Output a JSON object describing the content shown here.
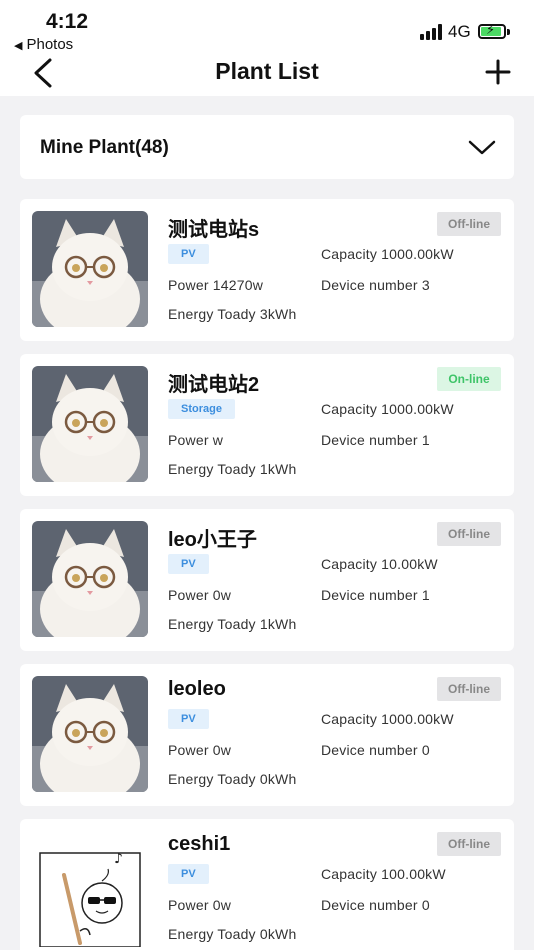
{
  "status_bar": {
    "time": "4:12",
    "back_app": "Photos",
    "network": "4G",
    "battery_color": "#4cd964"
  },
  "nav": {
    "title": "Plant List",
    "back_icon": "chevron-left-icon",
    "add_icon": "plus-icon"
  },
  "filter": {
    "label": "Mine Plant(48)",
    "icon": "chevron-down-icon"
  },
  "plants": [
    {
      "name": "测试电站s",
      "status": "Off-line",
      "type": "PV",
      "capacity": "Capacity  1000.00kW",
      "power": "Power  14270w",
      "devices": "Device number  3",
      "energy": "Energy Toady  3kWh",
      "thumb": "cat"
    },
    {
      "name": "测试电站2",
      "status": "On-line",
      "type": "Storage",
      "capacity": "Capacity  1000.00kW",
      "power": "Power  w",
      "devices": "Device number  1",
      "energy": "Energy Toady  1kWh",
      "thumb": "cat"
    },
    {
      "name": "leo小王子",
      "status": "Off-line",
      "type": "PV",
      "capacity": "Capacity  10.00kW",
      "power": "Power  0w",
      "devices": "Device number  1",
      "energy": "Energy Toady  1kWh",
      "thumb": "cat"
    },
    {
      "name": "leoleo",
      "status": "Off-line",
      "type": "PV",
      "capacity": "Capacity  1000.00kW",
      "power": "Power  0w",
      "devices": "Device number  0",
      "energy": "Energy Toady  0kWh",
      "thumb": "cat"
    },
    {
      "name": "ceshi1",
      "status": "Off-line",
      "type": "PV",
      "capacity": "Capacity  100.00kW",
      "power": "Power  0w",
      "devices": "Device number  0",
      "energy": "Energy Toady  0kWh",
      "thumb": "sketch"
    }
  ],
  "colors": {
    "online_text": "#3ec468",
    "online_bg": "#dcf6e4",
    "offline_text": "#888888",
    "offline_bg": "#e4e4e6",
    "tag_text": "#3c8ede",
    "tag_bg": "#e3f0fc"
  }
}
